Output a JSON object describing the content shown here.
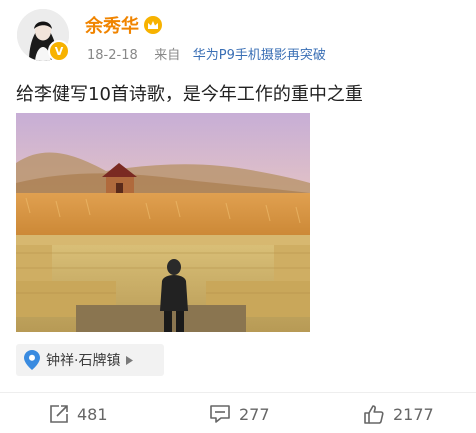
{
  "post": {
    "author": {
      "name": "余秀华",
      "avatar_icon": "avatar-portrait",
      "verified_icon": "verified-v-badge",
      "vip_icon": "vip-crown-icon"
    },
    "meta": {
      "date": "18-2-18",
      "from_label": "来自",
      "source": "华为P9手机摄影再突破"
    },
    "text": "给李健写10首诗歌，是今年工作的重中之重",
    "media": {
      "description_icon": "stage-photo"
    },
    "location": {
      "icon": "location-pin-icon",
      "label": "钟祥·石牌镇",
      "chevron_icon": "triangle-right-icon"
    }
  },
  "actions": {
    "repost": {
      "icon": "share-icon",
      "count": "481"
    },
    "comment": {
      "icon": "comment-icon",
      "count": "277"
    },
    "like": {
      "icon": "thumbs-up-icon",
      "count": "2177"
    }
  },
  "colors": {
    "username": "#f08400",
    "source_link": "#3a6fb5",
    "badge": "#f7b200",
    "location_pin": "#3a8be0"
  }
}
